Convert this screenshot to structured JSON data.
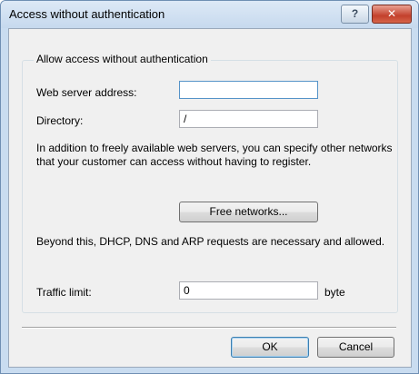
{
  "window": {
    "title": "Access without authentication"
  },
  "titlebar": {
    "help_glyph": "?",
    "close_glyph": "✕"
  },
  "group": {
    "title": "Allow access without authentication"
  },
  "form": {
    "web_server_label": "Web server address:",
    "web_server_value": "",
    "directory_label": "Directory:",
    "directory_value": "/",
    "info_text": "In addition to freely available web servers, you can specify other networks that your customer can access without having to register.",
    "free_networks_label": "Free networks...",
    "dhcp_text": "Beyond this, DHCP, DNS and ARP requests are necessary and allowed.",
    "traffic_label": "Traffic limit:",
    "traffic_value": "0",
    "traffic_unit": "byte"
  },
  "footer": {
    "ok_label": "OK",
    "cancel_label": "Cancel"
  }
}
